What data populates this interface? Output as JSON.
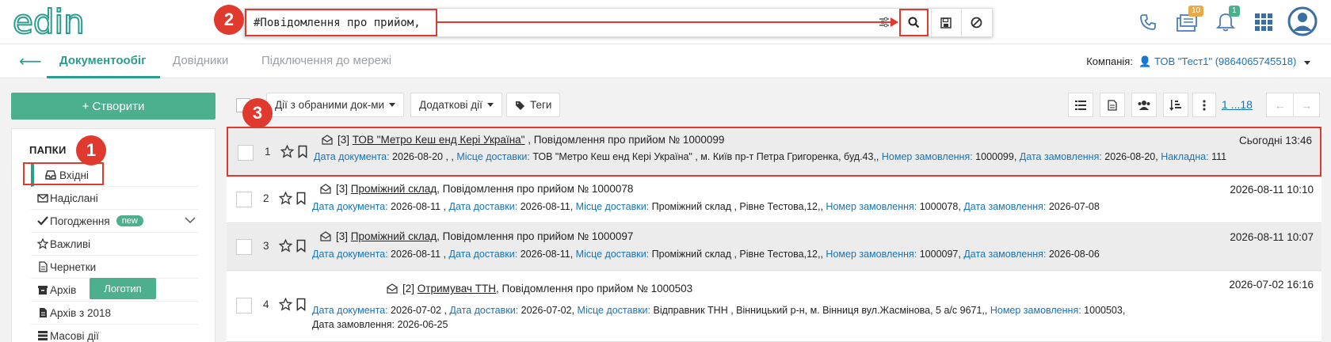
{
  "header": {
    "logo_text": "edin",
    "search": {
      "value": "#Повідомлення про прийом,",
      "placeholder": ""
    },
    "badges": {
      "docs_count": "10",
      "notifications_count": "1"
    },
    "colors": {
      "brand": "#2a9d8f",
      "accent_green": "#4caf8e",
      "link_blue": "#1a73b6",
      "highlight_red": "#e0392e"
    }
  },
  "callouts": [
    "1",
    "2",
    "3"
  ],
  "nav": {
    "tabs": [
      "Документообіг",
      "Довідники",
      "Підключення до мережі"
    ],
    "company_label": "Компанія:",
    "company_value": "ТОВ \"Тест1\" (9864065745518)"
  },
  "sidebar": {
    "create_label": "+ Створити",
    "folders_title": "ПАПКИ",
    "items": [
      {
        "label": "Вхідні",
        "icon": "inbox-icon"
      },
      {
        "label": "Надіслані",
        "icon": "envelope-icon"
      },
      {
        "label": "Погодження",
        "icon": "check-icon",
        "badge": "new"
      },
      {
        "label": "Важливі",
        "icon": "star-icon"
      },
      {
        "label": "Чернетки",
        "icon": "file-icon"
      },
      {
        "label": "Архів",
        "icon": "archive-icon"
      },
      {
        "label": "Архів з 2018",
        "icon": "file-icon"
      },
      {
        "label": "Масові дії",
        "icon": "stack-icon"
      }
    ]
  },
  "toolbar": {
    "bulk_actions": "Дії з обраними док-ми",
    "extra_actions": "Додаткові дії",
    "tags": "Теги",
    "pager": "1 ...18"
  },
  "documents": [
    {
      "num": "1",
      "count": "[3]",
      "party": "ТОВ \"Метро Кеш енд Кері Україна\"",
      "title": ", Повідомлення про прийом № 1000099",
      "date": "Сьогодні 13:46",
      "line1": [
        {
          "l": "Дата документа:",
          "v": " 2026-08-20 , , "
        },
        {
          "l": "Місце доставки:",
          "v": " ТОВ \"Метро Кеш енд Кері Україна\" , м. Київ пр-т Петра Григоренка, буд.43,, "
        },
        {
          "l": "Номер замовлення:",
          "v": " 1000099, "
        },
        {
          "l": "Дата замовлення:",
          "v": " 2026-08-20, "
        },
        {
          "l": "Накладна:",
          "v": " 111"
        }
      ],
      "line2": []
    },
    {
      "num": "2",
      "count": "[3]",
      "party": "Проміжний склад",
      "title": " , Повідомлення про прийом № 1000078",
      "date": "2026-08-11 10:10",
      "line1": [
        {
          "l": "Дата документа:",
          "v": " 2026-08-11 , "
        },
        {
          "l": "Дата доставки:",
          "v": " 2026-08-11, "
        },
        {
          "l": "Місце доставки:",
          "v": " Проміжний склад , Рівне Тестова,12,, "
        },
        {
          "l": "Номер замовлення:",
          "v": " 1000078, "
        },
        {
          "l": "Дата замовлення:",
          "v": " 2026-07-08"
        }
      ],
      "line2": []
    },
    {
      "num": "3",
      "count": "[3]",
      "party": "Проміжний склад",
      "title": " , Повідомлення про прийом № 1000097",
      "date": "2026-08-11 10:07",
      "line1": [
        {
          "l": "Дата документа:",
          "v": " 2026-08-11 , "
        },
        {
          "l": "Дата доставки:",
          "v": " 2026-08-11, "
        },
        {
          "l": "Місце доставки:",
          "v": " Проміжний склад , Рівне Тестова,12,, "
        },
        {
          "l": "Номер замовлення:",
          "v": " 1000097, "
        },
        {
          "l": "Дата замовлення:",
          "v": " 2026-08-06"
        }
      ],
      "line2": []
    },
    {
      "num": "4",
      "tag": "Логотип",
      "count": "[2]",
      "party": "Отримувач ТТН",
      "title": " , Повідомлення про прийом № 1000503",
      "date": "2026-07-02 16:16",
      "line1": [
        {
          "l": "Дата документа:",
          "v": " 2026-07-02 , "
        },
        {
          "l": "Дата доставки:",
          "v": " 2026-07-02, "
        },
        {
          "l": "Місце доставки:",
          "v": " Відправник ТНН , Вінницький р-н, м. Вінниця вул.Жасмінова, 5 а/с 9671,, "
        },
        {
          "l": "Номер замовлення:",
          "v": " 1000503,"
        }
      ],
      "line2": [
        {
          "l": "Дата замовлення:",
          "v": " 2026-06-25"
        }
      ]
    }
  ]
}
